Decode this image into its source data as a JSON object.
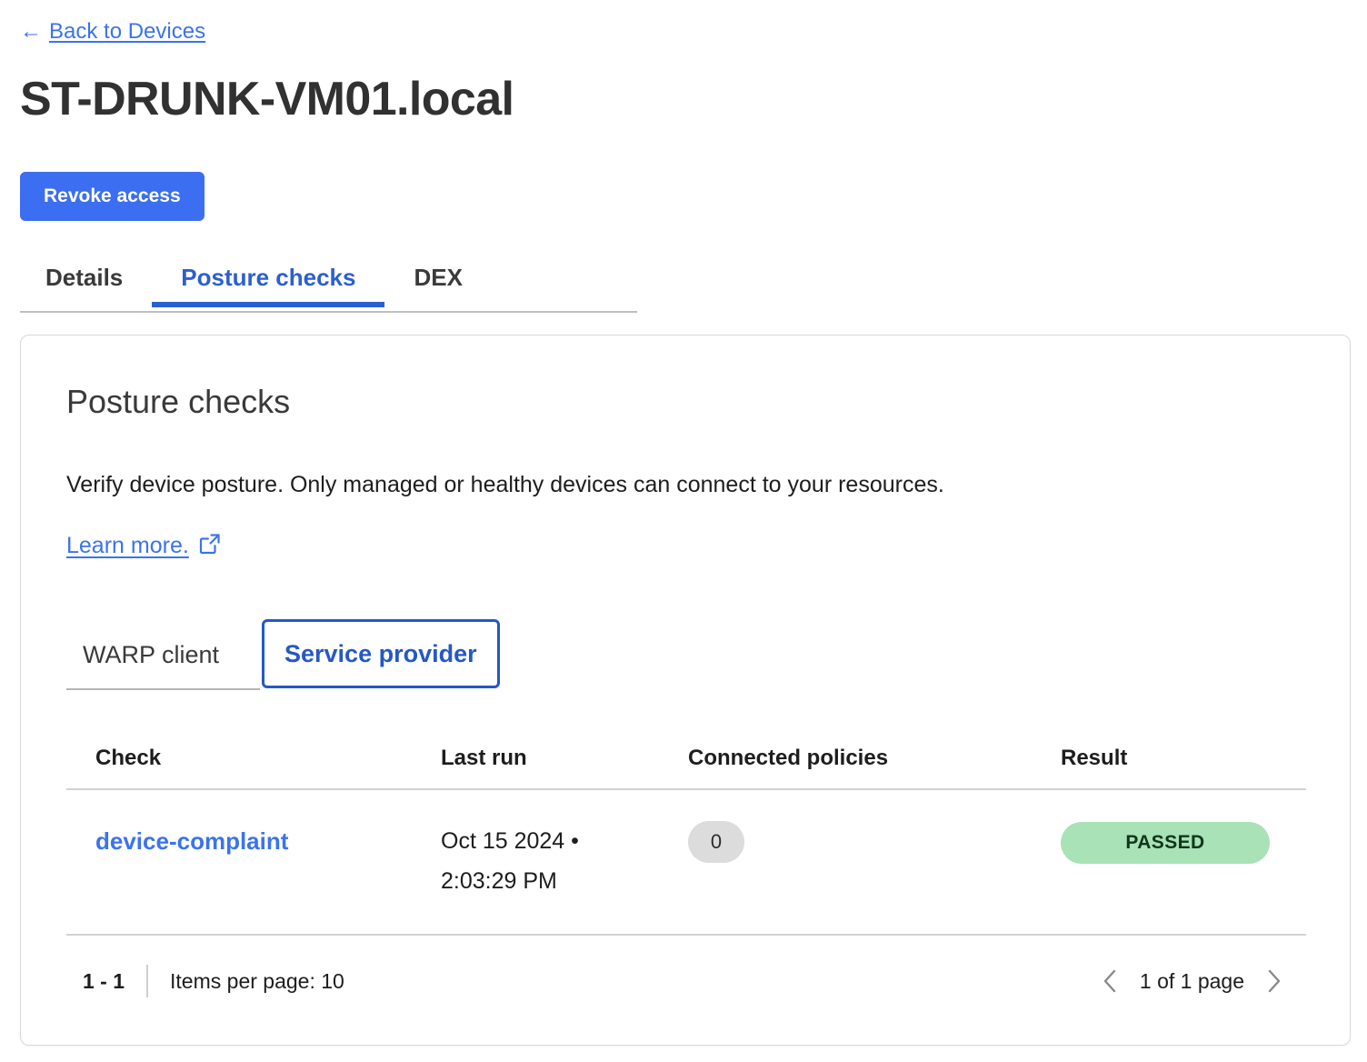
{
  "back_link": {
    "arrow": "←",
    "label": "Back to Devices"
  },
  "page_title": "ST-DRUNK-VM01.local",
  "primary_action": {
    "label": "Revoke access",
    "color": "#3b6ef0"
  },
  "tabs": [
    {
      "label": "Details",
      "active": false
    },
    {
      "label": "Posture checks",
      "active": true
    },
    {
      "label": "DEX",
      "active": false
    }
  ],
  "card": {
    "title": "Posture checks",
    "description": "Verify device posture. Only managed or healthy devices can connect to your resources.",
    "learn_more": {
      "label": "Learn more.",
      "icon": "external-link-icon"
    },
    "subtabs": [
      {
        "label": "WARP client",
        "active": false
      },
      {
        "label": "Service provider",
        "active": true
      }
    ],
    "table": {
      "columns": [
        "Check",
        "Last run",
        "Connected policies",
        "Result"
      ],
      "rows": [
        {
          "check": "device-complaint",
          "last_run_date": "Oct 15 2024 •",
          "last_run_time": "2:03:29 PM",
          "connected_policies": "0",
          "result": "PASSED",
          "result_color": "#a8e2b6"
        }
      ]
    },
    "footer": {
      "range": "1 - 1",
      "items_per_page": "Items per page: 10",
      "page_label": "1 of 1 page",
      "prev_icon": "chevron-left-icon",
      "next_icon": "chevron-right-icon"
    }
  }
}
